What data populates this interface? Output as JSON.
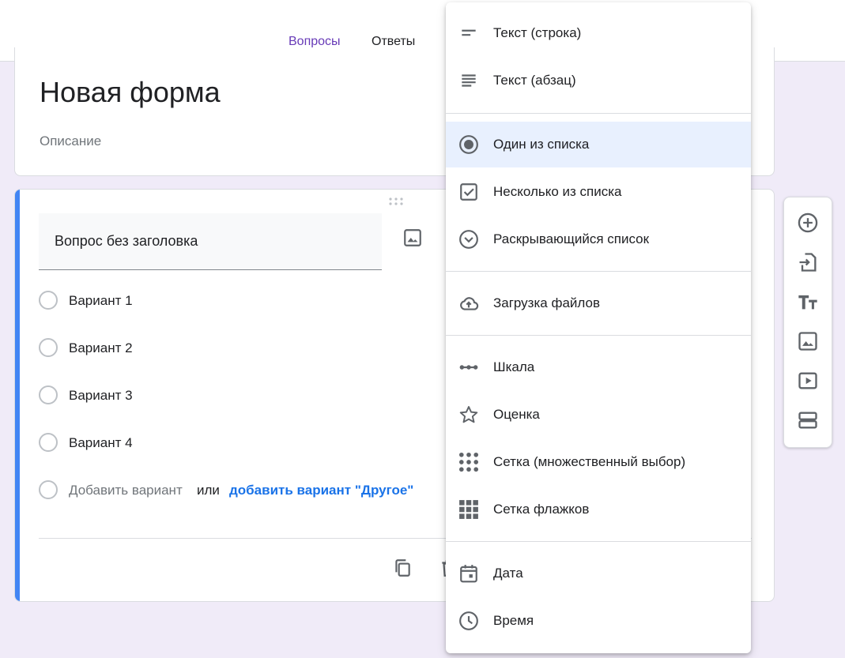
{
  "tabs": {
    "questions": "Вопросы",
    "responses": "Ответы"
  },
  "form": {
    "title": "Новая форма",
    "description": "Описание"
  },
  "question": {
    "title": "Вопрос без заголовка",
    "options": [
      "Вариант 1",
      "Вариант 2",
      "Вариант 3",
      "Вариант 4"
    ],
    "add_option": "Добавить вариант",
    "or": "или",
    "add_other": "добавить вариант \"Другое\""
  },
  "menu": {
    "selected": "Один из списка",
    "items": [
      {
        "label": "Текст (строка)",
        "icon": "short-answer-icon"
      },
      {
        "label": "Текст (абзац)",
        "icon": "paragraph-icon"
      },
      {
        "label": "Один из списка",
        "icon": "radio-button-icon"
      },
      {
        "label": "Несколько из списка",
        "icon": "checkbox-icon"
      },
      {
        "label": "Раскрывающийся список",
        "icon": "dropdown-icon"
      },
      {
        "label": "Загрузка файлов",
        "icon": "cloud-upload-icon"
      },
      {
        "label": "Шкала",
        "icon": "linear-scale-icon"
      },
      {
        "label": "Оценка",
        "icon": "star-icon"
      },
      {
        "label": "Сетка (множественный выбор)",
        "icon": "radio-grid-icon"
      },
      {
        "label": "Сетка флажков",
        "icon": "checkbox-grid-icon"
      },
      {
        "label": "Дата",
        "icon": "calendar-icon"
      },
      {
        "label": "Время",
        "icon": "clock-icon"
      }
    ]
  },
  "sidebar": {
    "buttons": [
      "add-question-icon",
      "import-questions-icon",
      "add-title-icon",
      "add-image-icon",
      "add-video-icon",
      "add-section-icon"
    ]
  },
  "colors": {
    "accent": "#673ab7",
    "link": "#1a73e8",
    "question_bar": "#4285f4",
    "background": "#f0ebf8",
    "selected": "#e8f0fe"
  }
}
